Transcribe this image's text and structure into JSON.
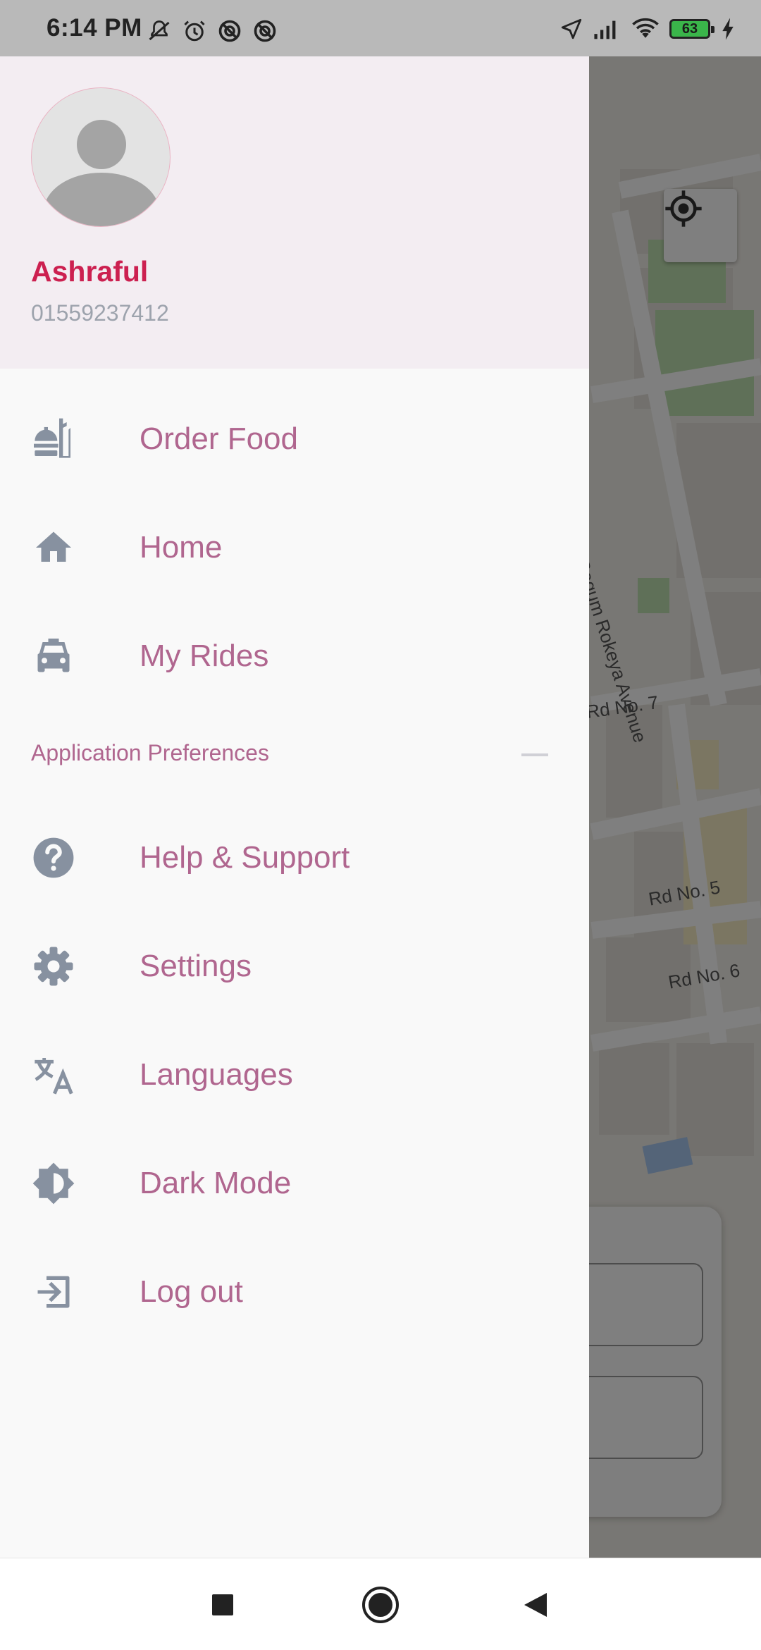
{
  "status_bar": {
    "time": "6:14 PM",
    "battery_level": "63",
    "left_icons": [
      "mute-icon",
      "alarm-icon",
      "notification-icon",
      "notification-icon"
    ],
    "right_icons": [
      "location-arrow-icon",
      "signal-icon",
      "wifi-icon",
      "battery-icon",
      "charging-icon"
    ]
  },
  "profile": {
    "name": "Ashraful",
    "phone": "01559237412"
  },
  "menu": {
    "primary": [
      {
        "label": "Order Food",
        "icon": "food-icon"
      },
      {
        "label": "Home",
        "icon": "home-icon"
      },
      {
        "label": "My Rides",
        "icon": "car-icon"
      }
    ],
    "section_title": "Application Preferences",
    "preferences": [
      {
        "label": "Help & Support",
        "icon": "help-icon"
      },
      {
        "label": "Settings",
        "icon": "gear-icon"
      },
      {
        "label": "Languages",
        "icon": "translate-icon"
      },
      {
        "label": "Dark Mode",
        "icon": "brightness-icon"
      },
      {
        "label": "Log out",
        "icon": "logout-icon"
      }
    ]
  },
  "map": {
    "labels": {
      "street_1": "Begum Rokeya Avenue",
      "street_2": "Rd No. 7",
      "street_3": "Rd No. 5",
      "street_4": "Rd No. 6"
    }
  },
  "colors": {
    "accent_name": "#cc2050",
    "menu_text": "#b0668f",
    "icon": "#8791a0",
    "header_bg": "#f3edf2"
  }
}
